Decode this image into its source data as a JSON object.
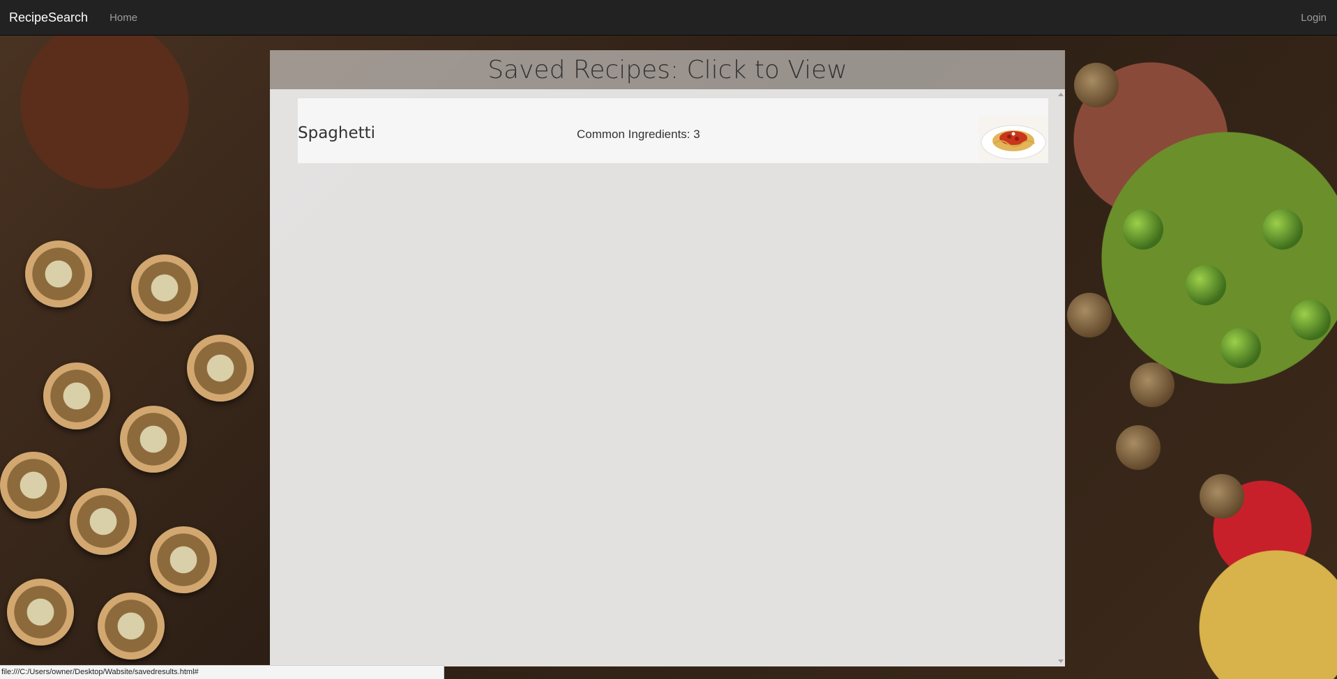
{
  "navbar": {
    "brand": "RecipeSearch",
    "home_label": "Home",
    "login_label": "Login"
  },
  "page": {
    "title": "Saved Recipes: Click to View"
  },
  "recipes": [
    {
      "name": "Spaghetti",
      "common_ingredients": "Common Ingredients: 3",
      "thumbnail_icon": "spaghetti-plate-image"
    }
  ],
  "status_bar": {
    "url": "file:///C:/Users/owner/Desktop/Wabsite/savedresults.html#"
  },
  "colors": {
    "navbar_bg": "#222222",
    "brand_text": "#ffffff",
    "nav_link_text": "#9d9d9d",
    "panel_bg": "#f0f0f0"
  }
}
